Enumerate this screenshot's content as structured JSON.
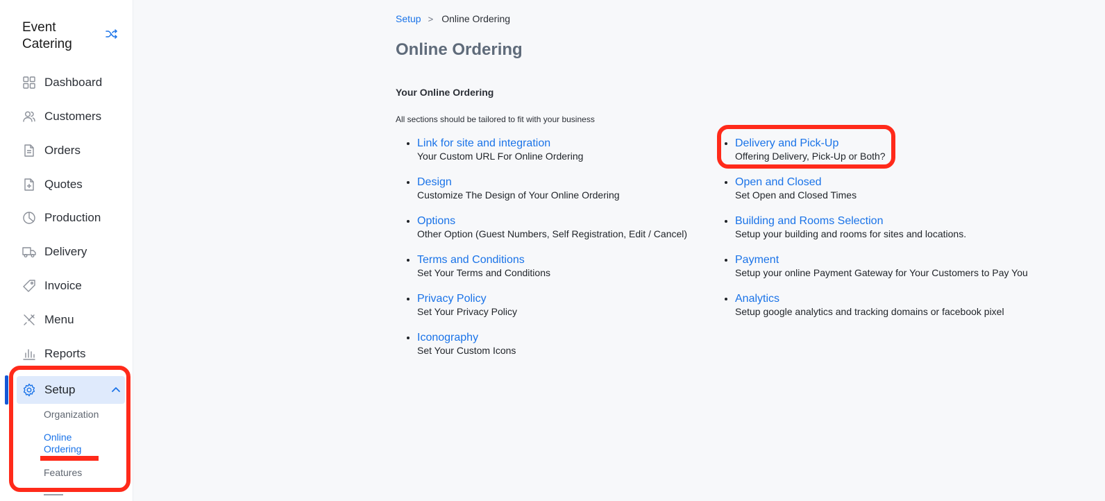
{
  "sidebar": {
    "brand": "Event Catering",
    "items": [
      {
        "label": "Dashboard",
        "icon": "grid-icon"
      },
      {
        "label": "Customers",
        "icon": "users-icon"
      },
      {
        "label": "Orders",
        "icon": "document-icon"
      },
      {
        "label": "Quotes",
        "icon": "quote-doc-icon"
      },
      {
        "label": "Production",
        "icon": "pie-chart-icon"
      },
      {
        "label": "Delivery",
        "icon": "truck-icon"
      },
      {
        "label": "Invoice",
        "icon": "tag-icon"
      },
      {
        "label": "Menu",
        "icon": "utensils-icon"
      },
      {
        "label": "Reports",
        "icon": "bar-chart-icon"
      },
      {
        "label": "Setup",
        "icon": "gear-icon"
      }
    ],
    "setup_sub": [
      {
        "label": "Organization"
      },
      {
        "label": "Online Ordering"
      },
      {
        "label": "Features"
      }
    ]
  },
  "breadcrumb": {
    "root": "Setup",
    "separator": ">",
    "current": "Online Ordering"
  },
  "page_title": "Online Ordering",
  "section": {
    "title": "Your Online Ordering",
    "description": "All sections should be tailored to fit with your business"
  },
  "left_list": [
    {
      "title": "Link for site and integration",
      "desc": "Your Custom URL For Online Ordering"
    },
    {
      "title": "Design",
      "desc": "Customize The Design of Your Online Ordering"
    },
    {
      "title": "Options",
      "desc": "Other Option (Guest Numbers, Self Registration, Edit / Cancel)"
    },
    {
      "title": "Terms and Conditions",
      "desc": "Set Your Terms and Conditions"
    },
    {
      "title": "Privacy Policy",
      "desc": "Set Your Privacy Policy"
    },
    {
      "title": "Iconography",
      "desc": "Set Your Custom Icons"
    }
  ],
  "right_list": [
    {
      "title": "Delivery and Pick-Up",
      "desc": "Offering Delivery, Pick-Up or Both?"
    },
    {
      "title": "Open and Closed",
      "desc": "Set Open and Closed Times"
    },
    {
      "title": "Building and Rooms Selection",
      "desc": "Setup your building and rooms for sites and locations."
    },
    {
      "title": "Payment",
      "desc": "Setup your online Payment Gateway for Your Customers to Pay You"
    },
    {
      "title": "Analytics",
      "desc": "Setup google analytics and tracking domains or facebook pixel"
    }
  ],
  "colors": {
    "accent": "#1a73e8",
    "highlight": "#ff2a1a",
    "active_bg": "#dfeafc"
  }
}
